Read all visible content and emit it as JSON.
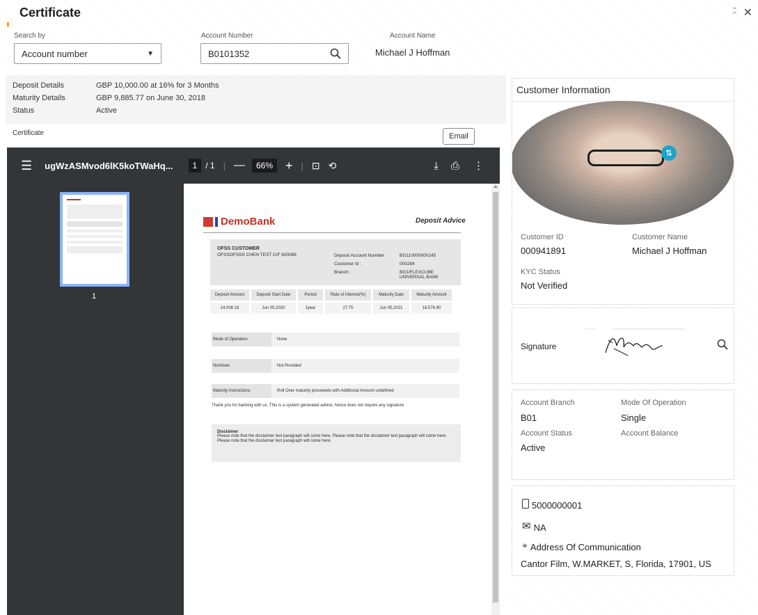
{
  "header": {
    "title": "Certificate"
  },
  "search": {
    "search_by_label": "Search by",
    "search_by_value": "Account number",
    "account_number_label": "Account Number",
    "account_number_value": "B0101352",
    "account_name_label": "Account Name",
    "account_name_value": "Michael J Hoffman"
  },
  "summary": {
    "rows": [
      {
        "k": "Deposit Details",
        "v": "GBP 10,000.00 at 16% for 3 Months"
      },
      {
        "k": "Maturity Details",
        "v": "GBP 9,885.77 on June 30, 2018"
      },
      {
        "k": "Status",
        "v": "Active"
      }
    ]
  },
  "certificate": {
    "label": "Certificate",
    "email_button": "Email"
  },
  "pdf": {
    "filename": "ugWzASMvod6lK5koTWaHq...",
    "page_current": "1",
    "page_total": "/ 1",
    "zoom": "66%",
    "thumb_page": "1"
  },
  "doc": {
    "bank_name": "DemoBank",
    "doc_title": "Deposit Advice",
    "customer_heading": "OFSS CUSTOMER",
    "customer_line": "OFSSOFSSS CHEN TEST CIF 600086",
    "deposit_account_label": "Deposit Account Number :",
    "deposit_account_value": "BG110000000145",
    "customer_id_label": "Customer Id :",
    "customer_id_value": "000284",
    "branch_label": "Branch :",
    "branch_value": "BG1/FLEXCUBE UNIVERSAL BANK",
    "table_headers": [
      "Deposit Amount",
      "Deposit Start Date",
      "Period",
      "Rate of Interest(%)",
      "Maturity Date",
      "Maturity Amount"
    ],
    "table_values": [
      "14,008.18",
      "Jun 05,2020",
      "1year",
      "27.75",
      "Jun 05,2021",
      "18,576.90"
    ],
    "mode_label": "Mode of Operation",
    "mode_value": "None",
    "nominee_label": "Nominee",
    "nominee_value": "Not Provided",
    "maturity_label": "Maturity Instructions",
    "maturity_value": "Roll Over maturity proceeeds with Additional Amount undefined",
    "thanks": "Thank you for banking with us. This is a system generated advice, hence does not require any signature.",
    "disclaimer_title": "Disclaimer",
    "disclaimer_text": "Please note that the disclaimer text paragraph will come here. Please note that the disclaimer text paragraph will come here. Please note that the disclaimer text paragraph will come here."
  },
  "customer": {
    "section_title": "Customer Information",
    "customer_id_label": "Customer ID",
    "customer_id_value": "000941891",
    "customer_name_label": "Customer Name",
    "customer_name_value": "Michael J Hoffman",
    "kyc_label": "KYC Status",
    "kyc_value": "Not Verified",
    "signature_label": "Signature",
    "account_branch_label": "Account Branch",
    "account_branch_value": "B01",
    "mode_label": "Mode Of Operation",
    "mode_value": "Single",
    "account_status_label": "Account Status",
    "account_status_value": "Active",
    "account_balance_label": "Account Balance",
    "phone": "5000000001",
    "email": "NA",
    "address_label": "Address Of Communication",
    "address_value": "Cantor Film, W.MARKET, S, Florida, 17901, US"
  }
}
